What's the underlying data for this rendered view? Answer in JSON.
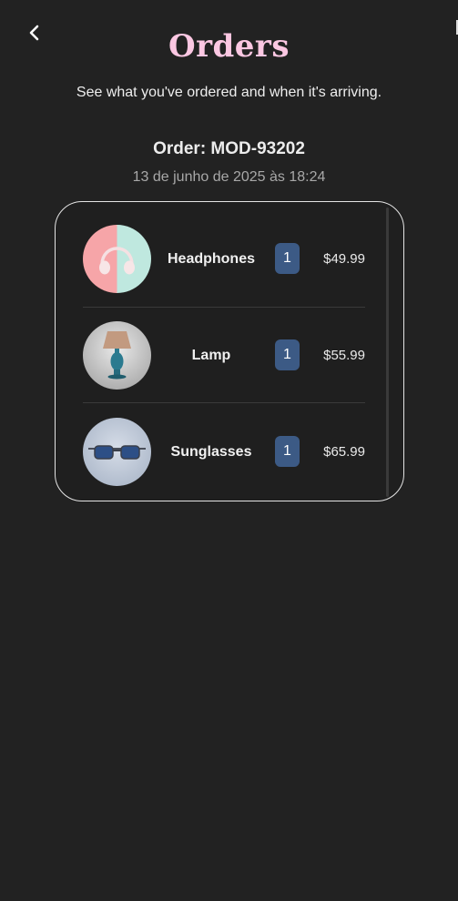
{
  "header": {
    "title": "Orders",
    "subtitle": "See what you've ordered and when it's arriving."
  },
  "order": {
    "number_label": "Order: MOD-93202",
    "date": "13 de junho de 2025 às 18:24"
  },
  "items": [
    {
      "name": "Headphones",
      "quantity": "1",
      "price": "$49.99",
      "icon": "headphones-image"
    },
    {
      "name": "Lamp",
      "quantity": "1",
      "price": "$55.99",
      "icon": "lamp-image"
    },
    {
      "name": "Sunglasses",
      "quantity": "1",
      "price": "$65.99",
      "icon": "sunglasses-image"
    }
  ],
  "colors": {
    "background": "#222222",
    "title": "#fbc7e2",
    "quantity_badge": "#3c5a85",
    "card_border": "#e4e4e4"
  }
}
